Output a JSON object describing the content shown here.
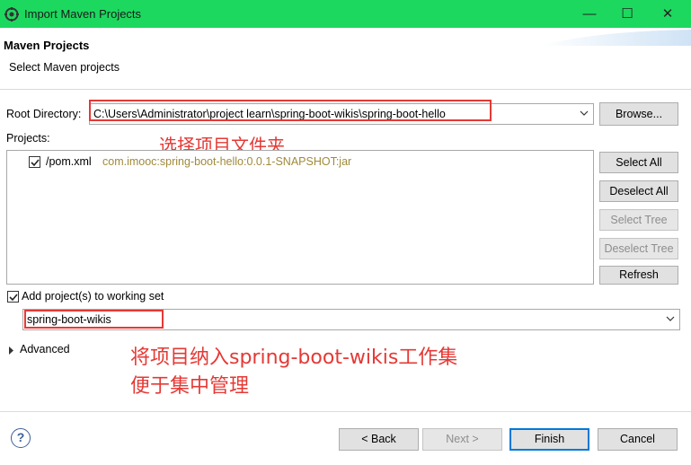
{
  "window": {
    "title": "Import Maven Projects",
    "controls": {
      "minimize": "—",
      "maximize": "☐",
      "close": "✕"
    }
  },
  "header": {
    "title": "Maven Projects",
    "subtitle": "Select Maven projects"
  },
  "root_directory": {
    "label": "Root Directory:",
    "value": "C:\\Users\\Administrator\\project learn\\spring-boot-wikis\\spring-boot-hello",
    "browse_label": "Browse..."
  },
  "projects": {
    "label": "Projects:",
    "items": [
      {
        "name": "/pom.xml",
        "artifact": "com.imooc:spring-boot-hello:0.0.1-SNAPSHOT:jar",
        "checked": true
      }
    ]
  },
  "side_buttons": {
    "select_all": "Select All",
    "deselect_all": "Deselect All",
    "select_tree": "Select Tree",
    "deselect_tree": "Deselect Tree",
    "refresh": "Refresh"
  },
  "working_set": {
    "checkbox_label": "Add project(s) to working set",
    "checked": true,
    "value": "spring-boot-wikis"
  },
  "advanced": {
    "label": "Advanced"
  },
  "annotations": {
    "select_folder": "选择项目文件夹",
    "line1": "将项目纳入spring-boot-wikis工作集",
    "line2": "便于集中管理"
  },
  "footer": {
    "help": "?",
    "back": "< Back",
    "next": "Next >",
    "finish": "Finish",
    "cancel": "Cancel"
  },
  "colors": {
    "titlebar": "#1dd85f",
    "annotation": "#e53935",
    "artifact_text": "#a08a3a"
  }
}
